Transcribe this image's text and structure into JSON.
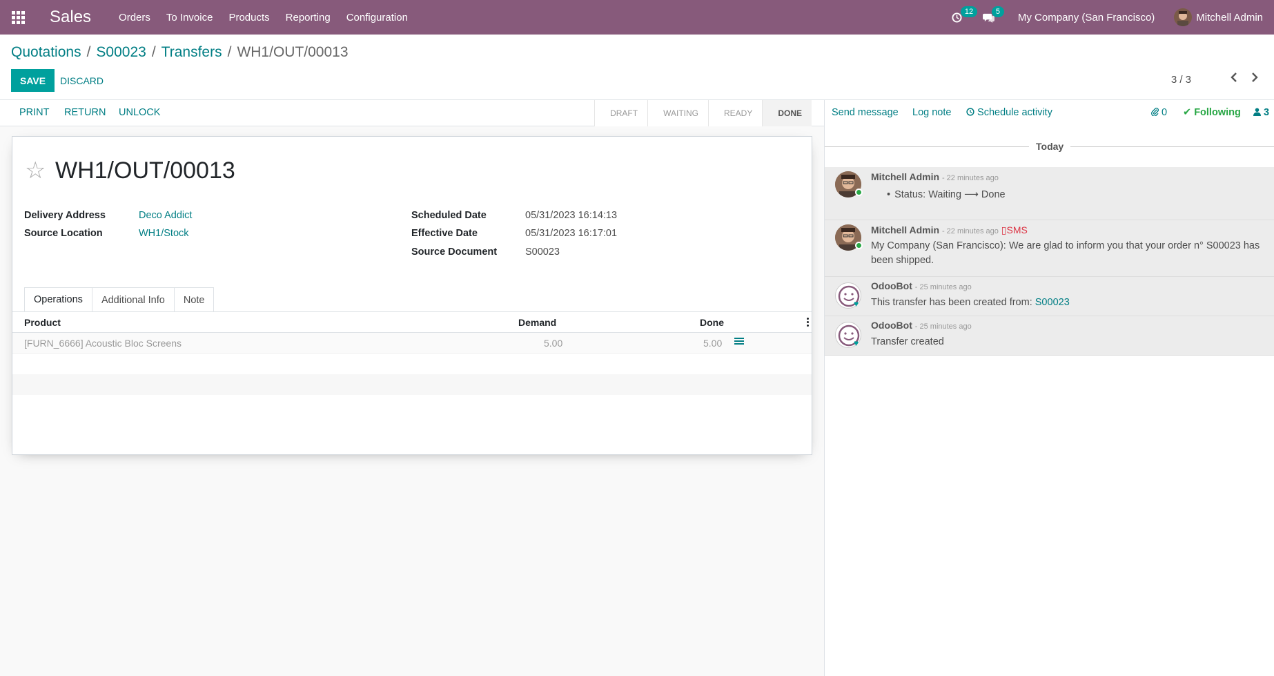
{
  "navbar": {
    "app_name": "Sales",
    "menu": [
      "Orders",
      "To Invoice",
      "Products",
      "Reporting",
      "Configuration"
    ],
    "activity_badge": "12",
    "messages_badge": "5",
    "company": "My Company (San Francisco)",
    "user": "Mitchell Admin",
    "icons": [
      "apps-grid-icon",
      "clock-icon",
      "chat-icon"
    ]
  },
  "breadcrumb": {
    "items": [
      "Quotations",
      "S00023",
      "Transfers"
    ],
    "current": "WH1/OUT/00013"
  },
  "buttons": {
    "save": "SAVE",
    "discard": "DISCARD"
  },
  "pager": {
    "value": "3 / 3"
  },
  "statusbar": {
    "actions": [
      "PRINT",
      "RETURN",
      "UNLOCK"
    ],
    "stages": [
      "DRAFT",
      "WAITING",
      "READY",
      "DONE"
    ],
    "current_stage": "DONE"
  },
  "record": {
    "title": "WH1/OUT/00013",
    "fields_left": [
      {
        "label": "Delivery Address",
        "value": "Deco Addict"
      },
      {
        "label": "Source Location",
        "value": "WH1/Stock"
      }
    ],
    "fields_right": [
      {
        "label": "Scheduled Date",
        "value": "05/31/2023 16:14:13"
      },
      {
        "label": "Effective Date",
        "value": "05/31/2023 16:17:01"
      },
      {
        "label": "Source Document",
        "value": "S00023"
      }
    ]
  },
  "tabs": [
    "Operations",
    "Additional Info",
    "Note"
  ],
  "operations": {
    "columns": [
      "Product",
      "Demand",
      "Done"
    ],
    "rows": [
      {
        "product": "[FURN_6666] Acoustic Bloc Screens",
        "demand": "5.00",
        "done": "5.00"
      }
    ]
  },
  "chatter": {
    "send_message": "Send message",
    "log_note": "Log note",
    "schedule_activity": "Schedule activity",
    "attachments": "0",
    "following": "Following",
    "followers": "3",
    "date_separator": "Today",
    "messages": [
      {
        "author": "Mitchell Admin",
        "date": "- 22 minutes ago",
        "tracking": "Status: Waiting",
        "tracking_new": "Done"
      },
      {
        "author": "Mitchell Admin",
        "date": "- 22 minutes ago",
        "tag": "SMS",
        "body": "My Company (San Francisco): We are glad to inform you that your order n° S00023 has been shipped."
      },
      {
        "author": "OdooBot",
        "date": "- 25 minutes ago",
        "body": "This transfer has been created from:",
        "link": "S00023"
      },
      {
        "author": "OdooBot",
        "date": "- 25 minutes ago",
        "body": "Transfer created"
      }
    ]
  },
  "colors": {
    "navbar": "#875a7b",
    "accent": "#00a09d",
    "link": "#017e84"
  }
}
